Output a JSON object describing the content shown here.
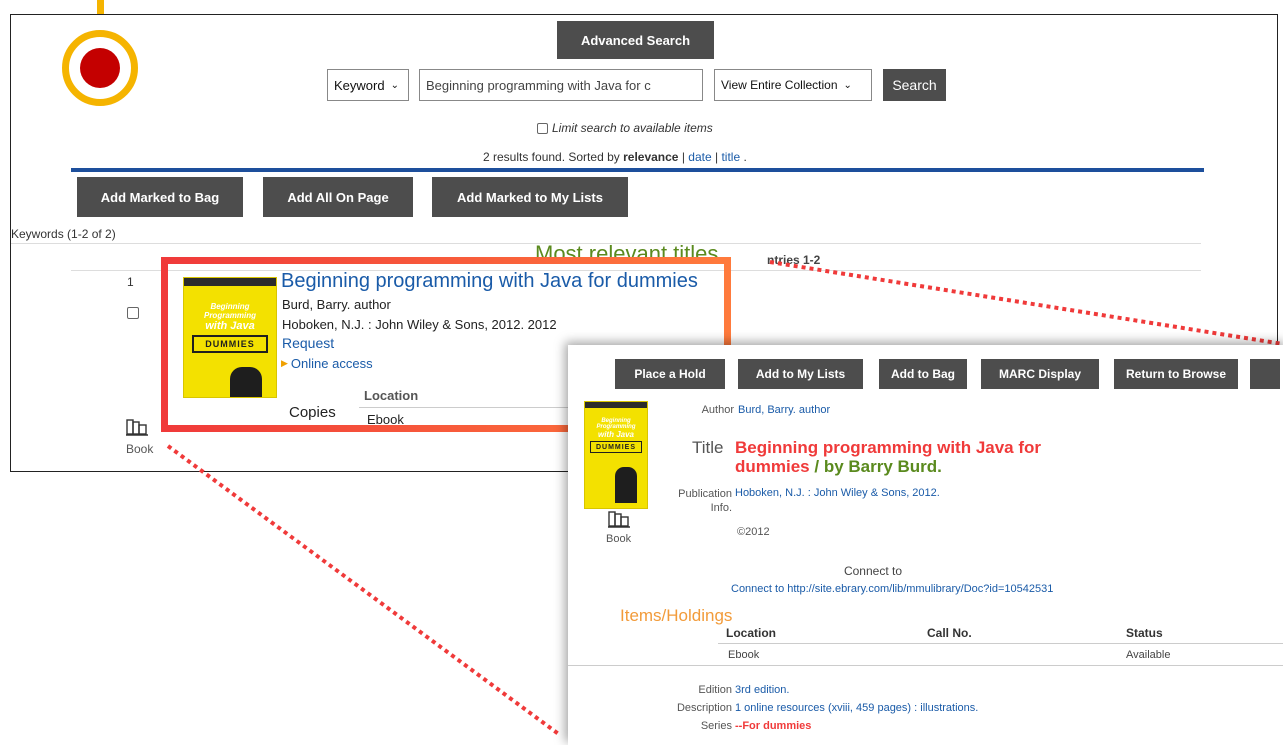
{
  "search": {
    "advanced_label": "Advanced Search",
    "type_value": "Keyword",
    "query_value": "Beginning programming with Java for c",
    "scope_value": "View Entire Collection",
    "search_label": "Search",
    "limit_label": "Limit search to available items"
  },
  "results_summary": {
    "prefix": "2 results found. Sorted by",
    "relevance": "relevance",
    "sep1": "|",
    "date": "date",
    "sep2": "|",
    "title": "title",
    "end": "."
  },
  "actions": {
    "add_marked_bag": "Add Marked to Bag",
    "add_all_page": "Add All On Page",
    "add_marked_lists": "Add Marked to My Lists"
  },
  "keywords_label": "Keywords (1-2 of 2)",
  "most_relevant": "Most relevant titles",
  "entries_label": "ntries 1-2",
  "result": {
    "number": "1",
    "title": "Beginning programming with Java for dummies",
    "author": "Burd, Barry. author",
    "publication": "Hoboken, N.J. : John Wiley & Sons, 2012. 2012",
    "request": "Request",
    "online_access": "Online access",
    "copies_label": "Copies",
    "location_header": "Location",
    "location_value": "Ebook",
    "format": "Book"
  },
  "cover": {
    "top_band": "",
    "line1": "Beginning Programming",
    "line2": "with Java",
    "brand": "DUMMIES"
  },
  "detail": {
    "buttons": [
      "Place a Hold",
      "Add to My Lists",
      "Add to Bag",
      "MARC Display",
      "Return to Browse"
    ],
    "author_label": "Author",
    "author_value": "Burd, Barry. author",
    "title_label": "Title",
    "title_red": "Beginning programming with Java for dummies",
    "title_green": "/ by Barry Burd.",
    "pub_label": "Publication Info.",
    "pub_value": "Hoboken, N.J. : John Wiley & Sons, 2012.",
    "copyright": "©2012",
    "format": "Book",
    "connect_label": "Connect to",
    "connect_link": "Connect to http://site.ebrary.com/lib/mmulibrary/Doc?id=10542531",
    "holdings_title": "Items/Holdings",
    "col_location": "Location",
    "col_callno": "Call No.",
    "col_status": "Status",
    "row_location": "Ebook",
    "row_status": "Available",
    "edition_label": "Edition",
    "edition_value": "3rd edition.",
    "description_label": "Description",
    "description_value": "1 online resources (xviii, 459 pages) : illustrations.",
    "series_label": "Series",
    "series_value": "--For dummies"
  },
  "colors": {
    "highlight_red": "#f03a3a",
    "highlight_orange": "#ff7a3c",
    "marker_gold": "#f5b400",
    "marker_red": "#c40000",
    "rule_blue": "#1d4f9c",
    "link_blue": "#1a5ba8",
    "heading_green": "#5a8a1e",
    "holdings_orange": "#f29b3a"
  }
}
